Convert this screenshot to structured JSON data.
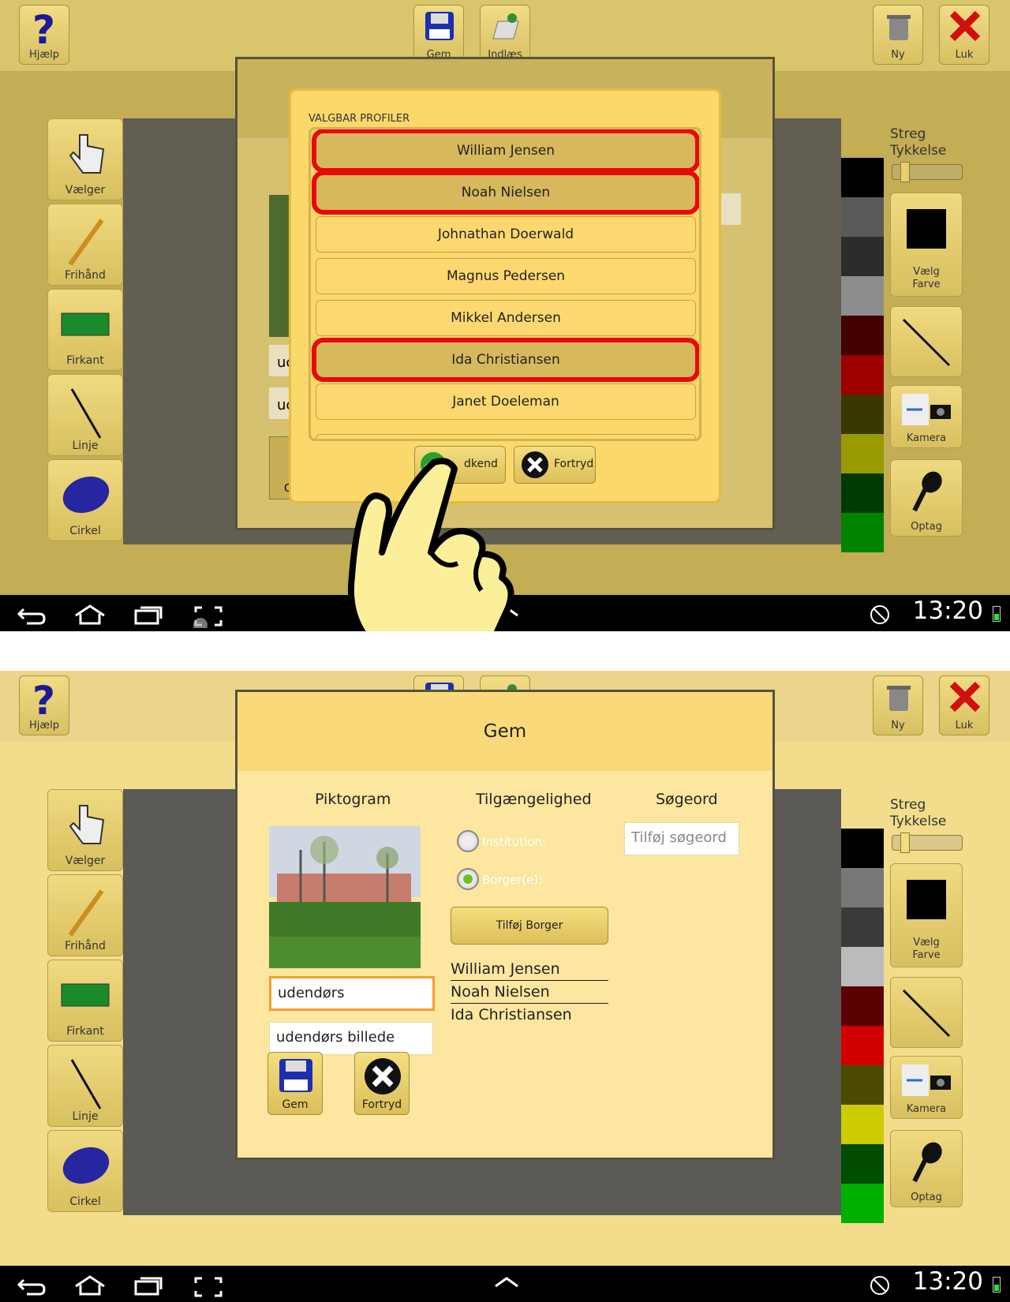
{
  "toolbar": {
    "help": "Hjælp",
    "save": "Gem",
    "import": "Indlæs",
    "new": "Ny",
    "close": "Luk"
  },
  "tools": {
    "select": "Vælger",
    "freehand": "Frihånd",
    "rectangle": "Firkant",
    "line": "Linje",
    "circle": "Cirkel"
  },
  "right_panel": {
    "stroke_title": "Streg\nTykkelse",
    "color_button": "Vælg\nFarve",
    "camera": "Kamera",
    "record": "Optag"
  },
  "status": {
    "time": "13:20"
  },
  "profiles_dialog": {
    "title": "VALGBAR PROFILER",
    "items": [
      {
        "name": "William Jensen",
        "selected": true
      },
      {
        "name": "Noah Nielsen",
        "selected": true
      },
      {
        "name": "Johnathan Doerwald",
        "selected": false
      },
      {
        "name": "Magnus Pedersen",
        "selected": false
      },
      {
        "name": "Mikkel Andersen",
        "selected": false
      },
      {
        "name": "Ida Christiansen",
        "selected": true
      },
      {
        "name": "Janet Doeleman",
        "selected": false
      }
    ],
    "confirm": "Godkend",
    "confirm_visible": "dkend",
    "cancel": "Fortryd"
  },
  "top_fields": {
    "field1": "uc",
    "field2": "uc",
    "btn_partial": "C"
  },
  "save_dialog": {
    "title": "Gem",
    "col_pictogram": "Piktogram",
    "col_access": "Tilgængelighed",
    "col_keywords": "Søgeord",
    "keyword_placeholder": "Tilføj søgeord",
    "radio_institution": "Institution:",
    "radio_citizen": "Borger(e):",
    "add_citizen": "Tilføj Borger",
    "citizens": [
      "William Jensen",
      "Noah Nielsen",
      "Ida Christiansen"
    ],
    "title_value": "udendørs",
    "description_value": "udendørs billede",
    "save": "Gem",
    "cancel": "Fortryd"
  },
  "colors": {
    "swatches": [
      "#000000",
      "#777777",
      "#3a3a3a",
      "#bbbbbb",
      "#5a0000",
      "#d00000",
      "#4a4a00",
      "#cccc00",
      "#004d00",
      "#00b000"
    ],
    "accent": "#e80a0a"
  }
}
